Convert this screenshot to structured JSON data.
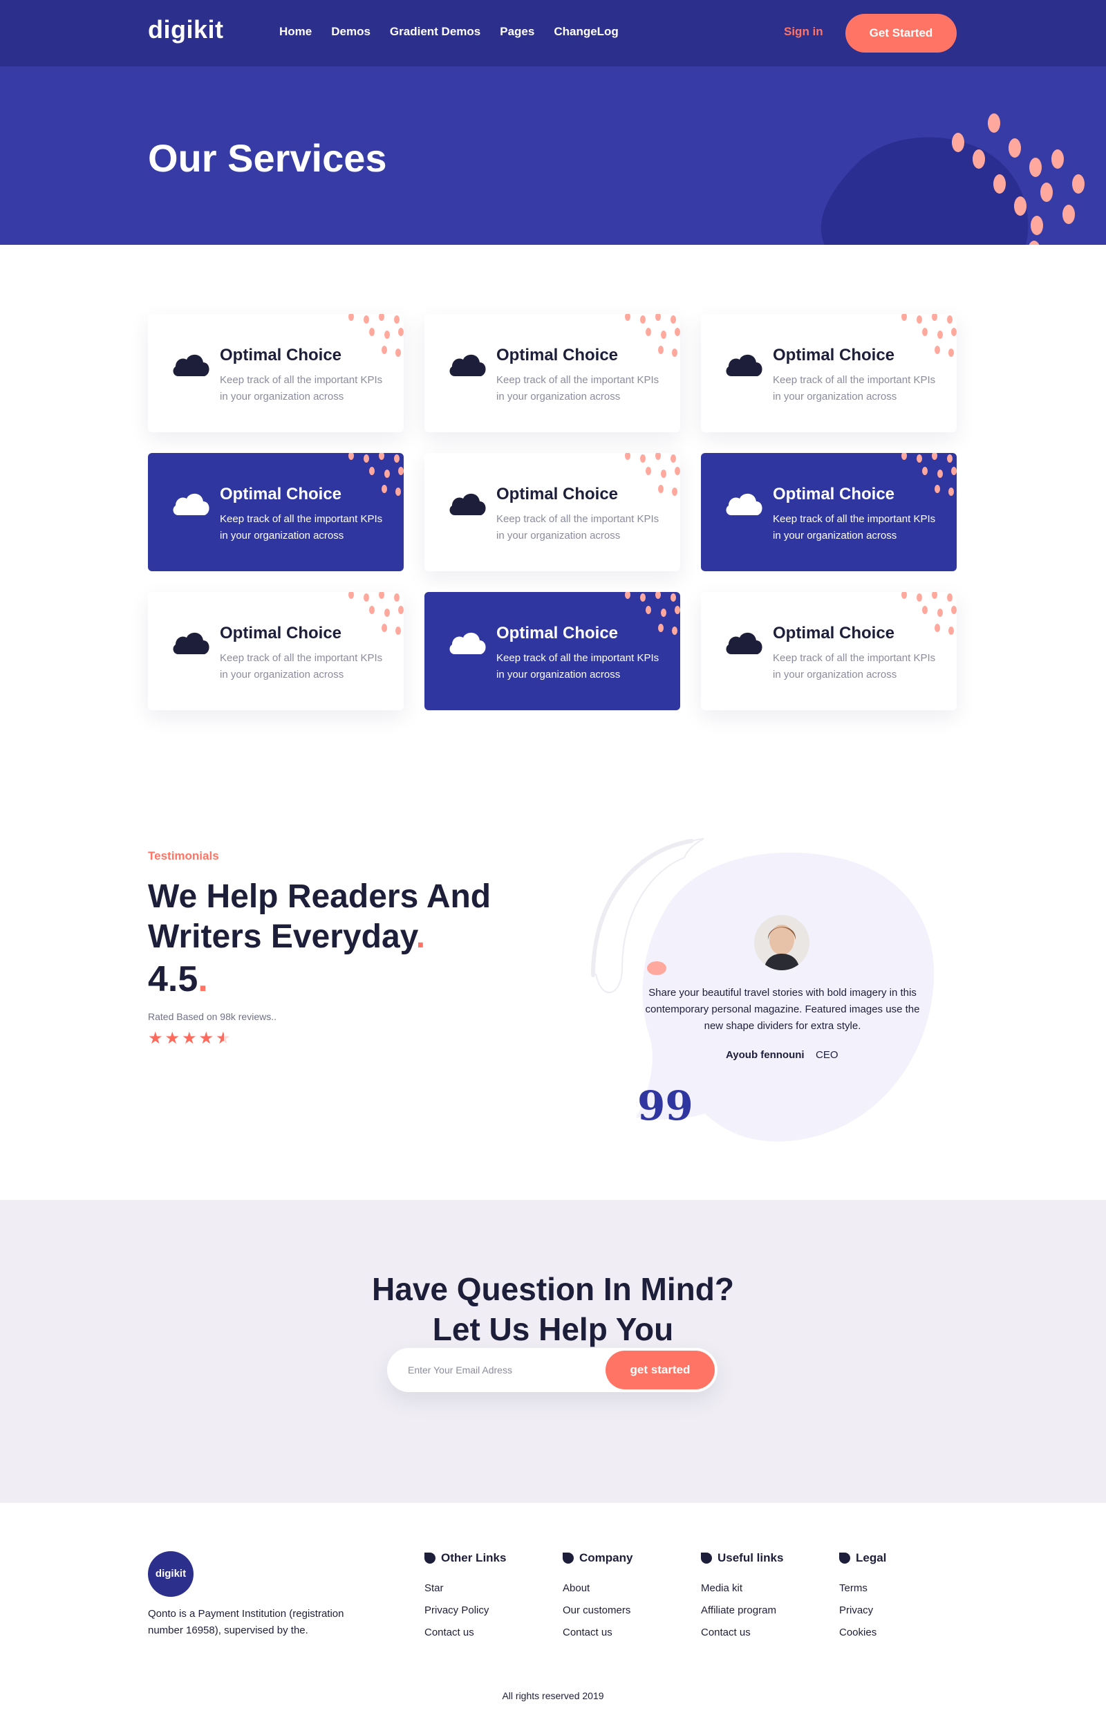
{
  "nav": {
    "logo": "digikit",
    "menu": [
      "Home",
      "Demos",
      "Gradient Demos",
      "Pages",
      "ChangeLog"
    ],
    "signin": "Sign in",
    "cta": "Get Started"
  },
  "hero": {
    "title": "Our Services"
  },
  "services": {
    "cards": [
      {
        "title": "Optimal Choice",
        "desc": "Keep track of all the important KPIs in your organization across",
        "style": "light"
      },
      {
        "title": "Optimal Choice",
        "desc": "Keep track of all the important KPIs in your organization across",
        "style": "light"
      },
      {
        "title": "Optimal Choice",
        "desc": "Keep track of all the important KPIs in your organization across",
        "style": "light"
      },
      {
        "title": "Optimal Choice",
        "desc": "Keep track of all the important KPIs in your organization across",
        "style": "dark"
      },
      {
        "title": "Optimal Choice",
        "desc": "Keep track of all the important KPIs in your organization across",
        "style": "light"
      },
      {
        "title": "Optimal Choice",
        "desc": "Keep track of all the important KPIs in your organization across",
        "style": "dark"
      },
      {
        "title": "Optimal Choice",
        "desc": "Keep track of all the important KPIs in your organization across",
        "style": "light"
      },
      {
        "title": "Optimal Choice",
        "desc": "Keep track of all the important KPIs in your organization across",
        "style": "dark"
      },
      {
        "title": "Optimal Choice",
        "desc": "Keep track of all the important KPIs in your organization across",
        "style": "light"
      }
    ]
  },
  "testimonials": {
    "kicker": "Testimonials",
    "heading": "We Help Readers And Writers Everyday",
    "heading_dot": ".",
    "rating": "4.5",
    "rating_dot": ".",
    "rated_text": "Rated Based on 98k reviews..",
    "stars": 4.5,
    "quote": "Share your beautiful travel stories with bold imagery in this contemporary personal magazine. Featured images use the new shape dividers for extra style.",
    "author": "Ayoub fennouni",
    "role": "CEO",
    "quote_mark": "99"
  },
  "cta": {
    "title_line1": "Have Question In Mind?",
    "title_line2": "Let Us Help You",
    "placeholder": "Enter Your Email Adress",
    "button": "get started"
  },
  "footer": {
    "logo": "digikit",
    "description": "Qonto is a Payment Institution (registration number 16958), supervised by the.",
    "columns": [
      {
        "title": "Other Links",
        "links": [
          "Star",
          "Privacy Policy",
          "Contact us"
        ]
      },
      {
        "title": "Company",
        "links": [
          "About",
          "Our customers",
          "Contact us"
        ]
      },
      {
        "title": "Useful links",
        "links": [
          "Media kit",
          "Affiliate program",
          "Contact us"
        ]
      },
      {
        "title": "Legal",
        "links": [
          "Terms",
          "Privacy",
          "Cookies"
        ]
      }
    ],
    "copyright": "All rights reserved 2019"
  },
  "colors": {
    "nav_bg": "#2c2f8c",
    "hero_bg": "#373ba6",
    "accent": "#ff7464",
    "card_dark": "#3036a0",
    "cta_bg": "#f0eef4"
  }
}
